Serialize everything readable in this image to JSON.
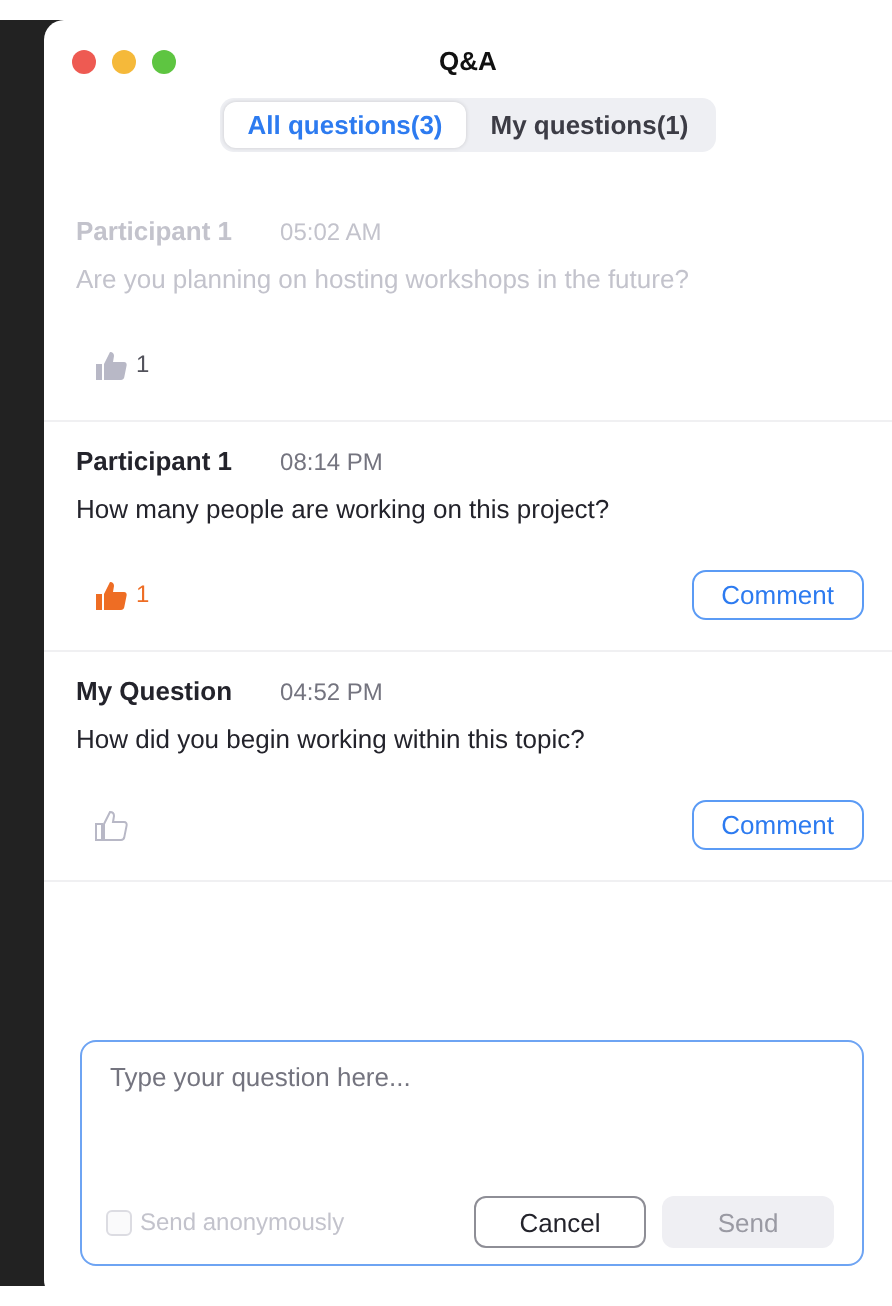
{
  "window": {
    "title": "Q&A"
  },
  "tabs": [
    {
      "label": "All questions(3)",
      "selected": true
    },
    {
      "label": "My questions(1)",
      "selected": false
    }
  ],
  "questions": [
    {
      "author": "Participant 1",
      "time": "05:02 AM",
      "text": "Are you planning on hosting workshops in the future?",
      "dimmed": true,
      "upvoted": false,
      "votes": "1"
    },
    {
      "author": "Participant 1",
      "time": "08:14 PM",
      "text": "How many people are working on this project?",
      "dimmed": false,
      "upvoted": true,
      "votes": "1",
      "comment_button": "Comment"
    },
    {
      "author": "My Question",
      "time": "04:52 PM",
      "text": "How did you begin working within this topic?",
      "dimmed": false,
      "upvoted": false,
      "comment_button": "Comment"
    }
  ],
  "composer": {
    "placeholder": "Type your question here...",
    "anonymous": {
      "label": "Send anonymously",
      "checked": false,
      "disabled": true
    },
    "cancel_button": "Cancel",
    "send_button": {
      "label": "Send",
      "disabled": true
    }
  }
}
